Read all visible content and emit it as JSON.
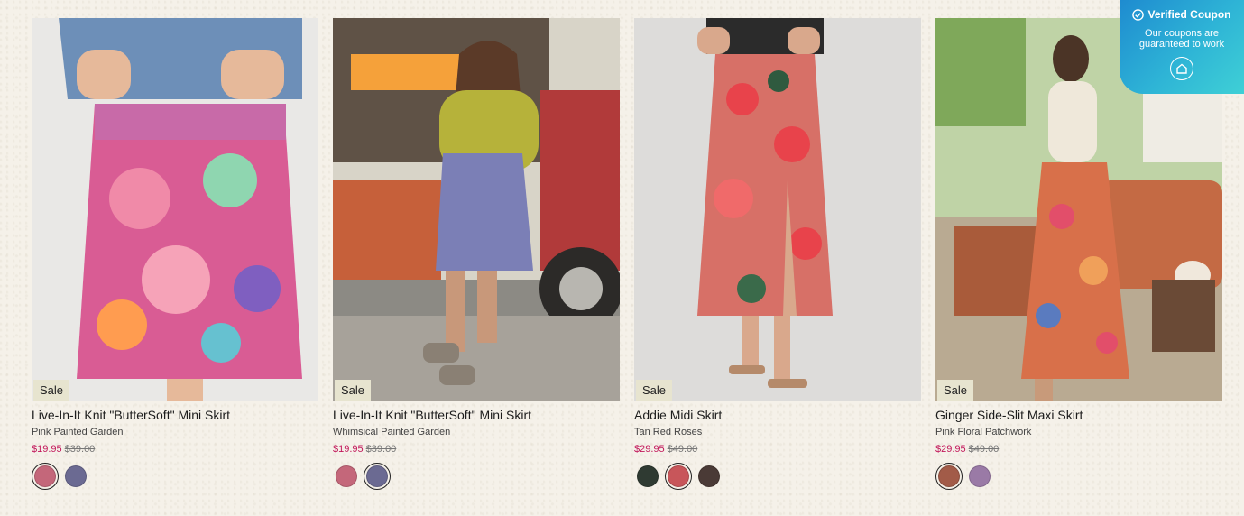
{
  "products": [
    {
      "title": "Live-In-It Knit \"ButterSoft\" Mini Skirt",
      "color_name": "Pink Painted Garden",
      "sale_price": "$19.95",
      "original_price": "$39.00",
      "badge": "Sale",
      "swatches": [
        {
          "name": "pink-painted-garden",
          "color": "#c4677a",
          "selected": true
        },
        {
          "name": "whimsical-painted-garden",
          "color": "#6b6a92",
          "selected": false
        }
      ]
    },
    {
      "title": "Live-In-It Knit \"ButterSoft\" Mini Skirt",
      "color_name": "Whimsical Painted Garden",
      "sale_price": "$19.95",
      "original_price": "$39.00",
      "badge": "Sale",
      "swatches": [
        {
          "name": "pink-painted-garden",
          "color": "#c4677a",
          "selected": false
        },
        {
          "name": "whimsical-painted-garden",
          "color": "#6b6a92",
          "selected": true
        }
      ]
    },
    {
      "title": "Addie Midi Skirt",
      "color_name": "Tan Red Roses",
      "sale_price": "$29.95",
      "original_price": "$49.00",
      "badge": "Sale",
      "swatches": [
        {
          "name": "black-floral",
          "color": "#2f3a32",
          "selected": false
        },
        {
          "name": "tan-red-roses",
          "color": "#c8565a",
          "selected": true
        },
        {
          "name": "dark-floral",
          "color": "#4a3a36",
          "selected": false
        }
      ]
    },
    {
      "title": "Ginger Side-Slit Maxi Skirt",
      "color_name": "Pink Floral Patchwork",
      "sale_price": "$29.95",
      "original_price": "$49.00",
      "badge": "Sale",
      "swatches": [
        {
          "name": "pink-floral-patchwork",
          "color": "#a25b48",
          "selected": true
        },
        {
          "name": "purple-patchwork",
          "color": "#9a7aa6",
          "selected": false
        }
      ]
    }
  ],
  "coupon": {
    "title": "Verified Coupon",
    "text": "Our coupons are guaranteed to work",
    "icon": "check-circle-icon",
    "logo_icon": "house-logo-icon"
  },
  "colors": {
    "sale_price": "#c2185b",
    "badge_bg": "#e7e4cf",
    "coupon_start": "#1e8bd0",
    "coupon_end": "#3fd0d6"
  }
}
